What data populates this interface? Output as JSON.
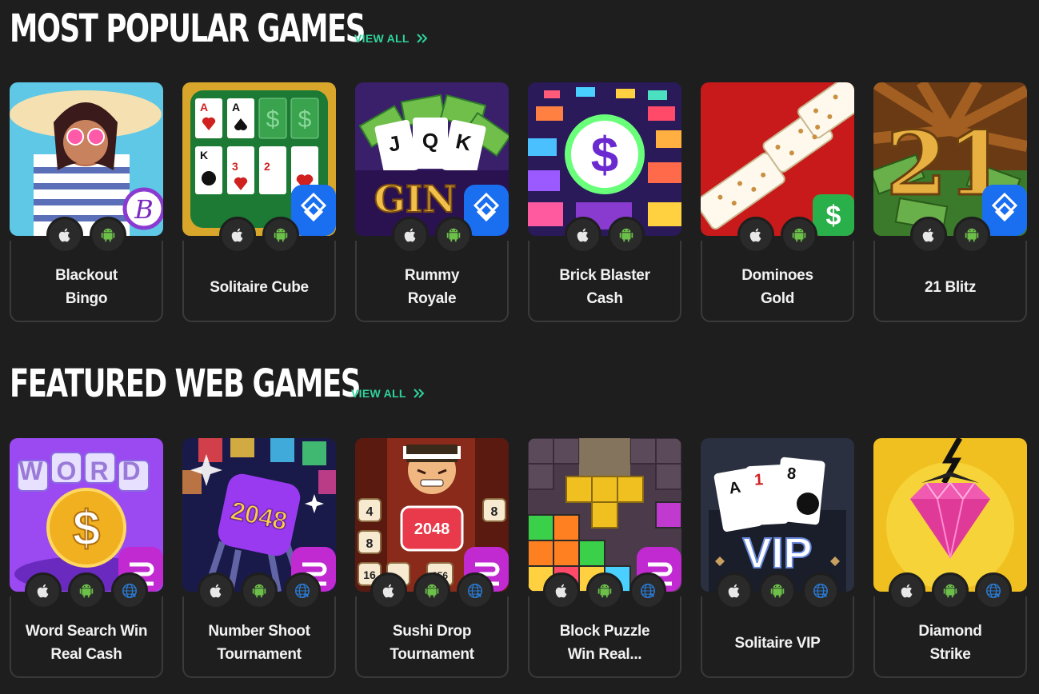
{
  "sections": [
    {
      "title": "MOST POPULAR GAMES",
      "view_all": "VIEW ALL",
      "games": [
        {
          "name": "Blackout Bingo",
          "platforms": [
            "apple-icon",
            "android-icon"
          ]
        },
        {
          "name": "Solitaire Cube",
          "platforms": [
            "apple-icon",
            "android-icon"
          ]
        },
        {
          "name": "Rummy Royale",
          "platforms": [
            "apple-icon",
            "android-icon"
          ]
        },
        {
          "name": "Brick Blaster Cash",
          "platforms": [
            "apple-icon",
            "android-icon"
          ]
        },
        {
          "name": "Dominoes Gold",
          "platforms": [
            "apple-icon",
            "android-icon"
          ]
        },
        {
          "name": "21 Blitz",
          "platforms": [
            "apple-icon",
            "android-icon"
          ]
        }
      ]
    },
    {
      "title": "FEATURED WEB GAMES",
      "view_all": "VIEW ALL",
      "games": [
        {
          "name": "Word Search Win Real Cash",
          "platforms": [
            "apple-icon",
            "android-icon",
            "web-icon"
          ]
        },
        {
          "name": "Number Shoot Tournament",
          "platforms": [
            "apple-icon",
            "android-icon",
            "web-icon"
          ]
        },
        {
          "name": "Sushi Drop Tournament",
          "platforms": [
            "apple-icon",
            "android-icon",
            "web-icon"
          ]
        },
        {
          "name": "Block Puzzle Win Real...",
          "platforms": [
            "apple-icon",
            "android-icon",
            "web-icon"
          ]
        },
        {
          "name": "Solitaire VIP",
          "platforms": [
            "apple-icon",
            "android-icon",
            "web-icon"
          ]
        },
        {
          "name": "Diamond Strike",
          "platforms": [
            "apple-icon",
            "android-icon",
            "web-icon"
          ]
        }
      ]
    }
  ],
  "thumb_text": {
    "bingo_letter": "B",
    "cards": [
      "A",
      "A",
      "K",
      "3",
      "2",
      "$",
      "$"
    ],
    "gin": "GIN",
    "gin_cards": [
      "J",
      "Q",
      "K"
    ],
    "dollar": "$",
    "blitz": "21",
    "word": "WORD",
    "num2048": "2048",
    "sushi_tiles": [
      "4",
      "8",
      "8",
      "16",
      "256"
    ],
    "vip": "VIP",
    "vip_cards": [
      "A",
      "1",
      "8"
    ]
  },
  "colors": {
    "accent": "#2fd39c",
    "background": "#1e1e1e",
    "android": "#6cc04a",
    "web": "#2a7bd4"
  }
}
